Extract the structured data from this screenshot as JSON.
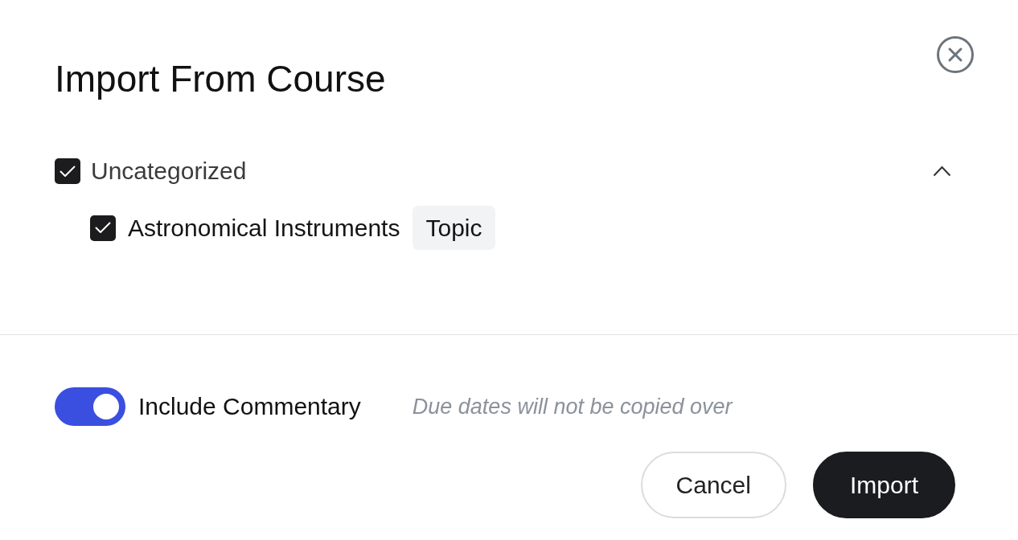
{
  "dialog": {
    "title": "Import From Course"
  },
  "tree": [
    {
      "label": "Uncategorized",
      "checked": true,
      "expanded": true,
      "children": [
        {
          "label": "Astronomical Instruments",
          "checked": true,
          "tag": "Topic"
        }
      ]
    }
  ],
  "include_commentary": {
    "label": "Include Commentary",
    "on": true
  },
  "note": "Due dates will not be copied over",
  "buttons": [
    {
      "label": "Cancel",
      "kind": "secondary"
    },
    {
      "label": "Import",
      "kind": "primary"
    }
  ]
}
